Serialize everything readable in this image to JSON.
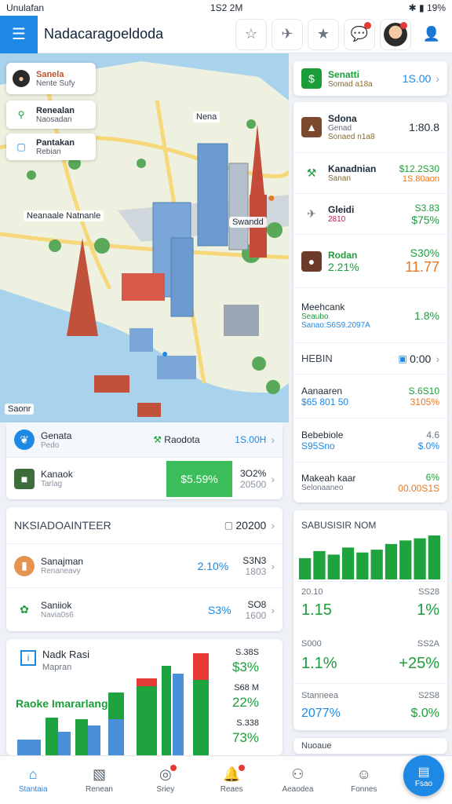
{
  "status": {
    "left": "Unulafan",
    "time": "1S2 2M",
    "battery": "19%"
  },
  "app": {
    "title": "Nadacaragoeldoda"
  },
  "toolbar": {
    "icons": [
      "star-outline-icon",
      "plane-icon",
      "star-icon",
      "chat-icon",
      "avatar",
      "profile-icon"
    ]
  },
  "map": {
    "cards": [
      {
        "title": "Sanela",
        "sub": "Nente Sufy"
      },
      {
        "title": "Renealan",
        "sub": "Naosadan"
      },
      {
        "title": "Pantakan",
        "sub": "Rebian"
      }
    ],
    "labels": {
      "top": "Nena",
      "west": "Neanaale Natnanle",
      "east": "Swandd",
      "corner": "Saonr"
    }
  },
  "right_top": {
    "label": "Senatti",
    "sub": "Somad a18a",
    "value": "1S.00"
  },
  "right_list": [
    {
      "name": "Sdona",
      "sub": "Genad",
      "sub2": "Sonaed n1a8",
      "v1": "1:80.8",
      "v2": ""
    },
    {
      "name": "Kanadnian",
      "sub": "Sanan",
      "v1": "$12.2S30",
      "v2": "1S.80aon"
    },
    {
      "name": "Gleidi",
      "sub": "2810",
      "v1": "S3.83",
      "v2": "$75%"
    },
    {
      "name": "Rodan",
      "sub": "2.21%",
      "v1": "S30%",
      "v2": "11.77"
    },
    {
      "name": "Meehcank",
      "sub": "Seaubo",
      "sub2": "Sanao:S6S9.2097A",
      "v1": "1.8%",
      "v2": ""
    }
  ],
  "right_header": {
    "label": "HEBIN",
    "value": "0:00"
  },
  "right_list2": [
    {
      "name": "Aanaaren",
      "sub": "$65 801 50",
      "v1": "S.6S10",
      "v2": "3105%"
    },
    {
      "name": "Bebebiole",
      "sub": "S95Sno",
      "v1": "4.6",
      "v2": "$.0%"
    },
    {
      "name": "Makeah kaar",
      "sub": "Selonaaneo",
      "v1": "6%",
      "v2": "00.00S1S"
    }
  ],
  "mid_cards": [
    {
      "name": "Genata",
      "sub": "Pedo",
      "label": "Raodota",
      "value": "1S.00H"
    },
    {
      "name": "Kanaok",
      "sub": "Tarlag",
      "badge": "$5.59%",
      "v1": "3O2%",
      "v2": "20500"
    }
  ],
  "section": {
    "title": "NKSIADOAINTEER",
    "value": "20200"
  },
  "section_rows": [
    {
      "name": "Sanajman",
      "sub": "Renaneavy",
      "pct": "2.10%",
      "v1": "S3N3",
      "v2": "1803"
    },
    {
      "name": "Saniiok",
      "sub": "Navia0s6",
      "pct": "S3%",
      "v1": "SO8",
      "v2": "1600"
    }
  ],
  "chart_panel": {
    "title": "Nadk Rasi",
    "sub": "Mapran",
    "caption": "Raoke Imararlang",
    "values": [
      "S.38S",
      "$3%",
      "S68 M",
      "22%",
      "S.338",
      "73%"
    ]
  },
  "right_chart": {
    "title": "SABUSISIR NOM",
    "stats": [
      {
        "label": "20.10",
        "value": "1.15"
      },
      {
        "label": "SS28",
        "value": "1%"
      },
      {
        "label": "S000",
        "value": "1.1%"
      },
      {
        "label": "SS2A",
        "value": "+25%"
      },
      {
        "label": "Stanneea",
        "value": "2077%"
      },
      {
        "label": "S2S8",
        "value": "$.0%"
      }
    ],
    "footer": "Nuoaue"
  },
  "chart_data": {
    "type": "bar",
    "series": [
      {
        "values": [
          3,
          4,
          3.5,
          4.5,
          3.8,
          4.2,
          5,
          5.5,
          5.8,
          6.2
        ]
      }
    ],
    "colors": [
      "#1fa33f"
    ]
  },
  "nav": [
    {
      "label": "Stantaia",
      "icon": "home-icon"
    },
    {
      "label": "Renean",
      "icon": "gallery-icon"
    },
    {
      "label": "Sriey",
      "icon": "target-icon"
    },
    {
      "label": "Reaes",
      "icon": "bell-icon"
    },
    {
      "label": "Aeaodea",
      "icon": "people-icon"
    },
    {
      "label": "Fonnes",
      "icon": "user-icon"
    }
  ],
  "fab": {
    "label": "Fsao"
  },
  "colors": {
    "accent": "#1e88e5",
    "green": "#1b9e3a",
    "orange": "#e87722"
  }
}
